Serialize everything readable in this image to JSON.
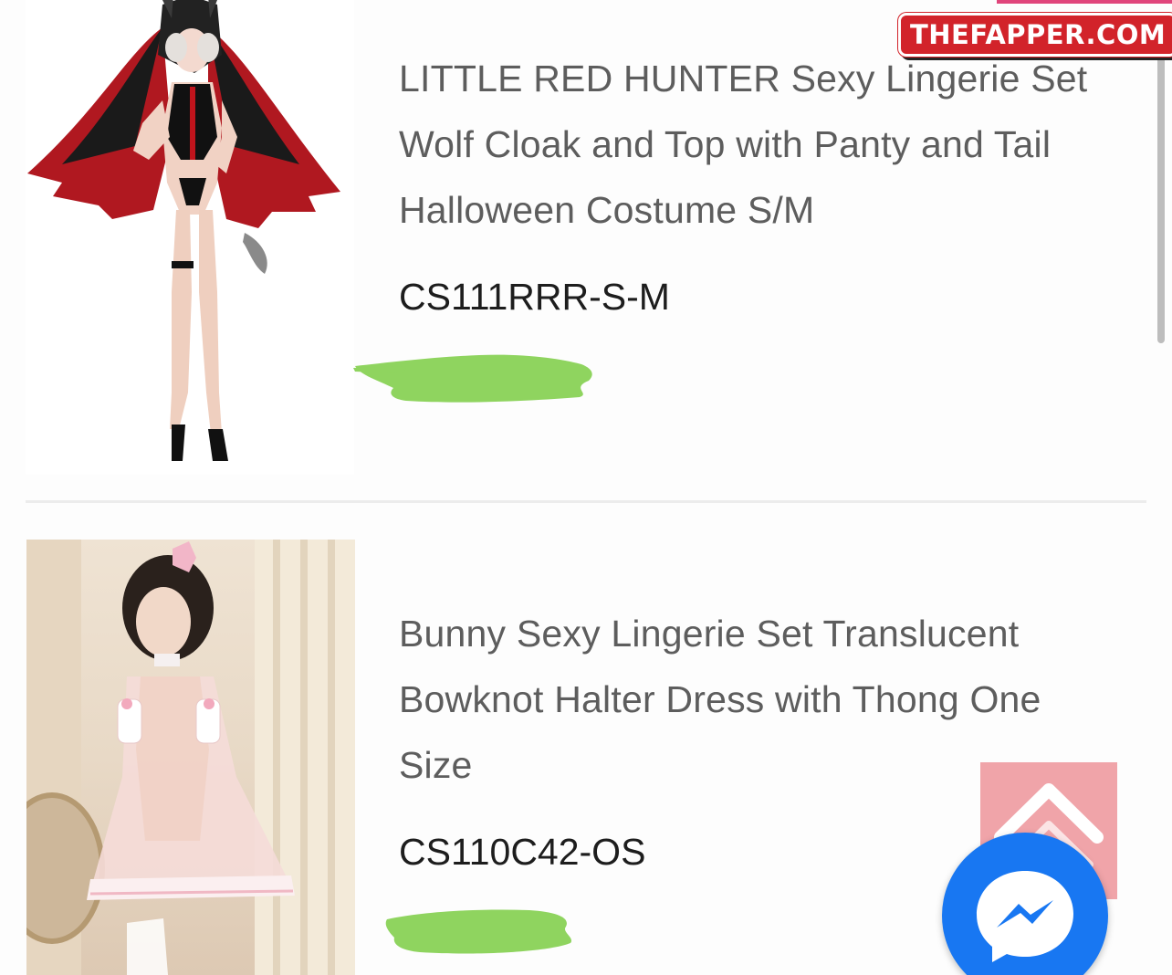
{
  "watermark": {
    "text": "THEFAPPER.COM"
  },
  "products": [
    {
      "title_lines": [
        "LITTLE RED HUNTER Sexy Lingerie Set",
        "Wolf Cloak and Top with Panty and Tail",
        "Halloween Costume S/M"
      ],
      "sku": "CS111RRR-S-M",
      "image_icon": "product-photo-icon",
      "price_redacted": true
    },
    {
      "title_lines": [
        "Bunny Sexy Lingerie Set Translucent",
        "Bowknot Halter Dress with Thong One",
        "Size"
      ],
      "sku": "CS110C42-OS",
      "image_icon": "product-photo-icon",
      "price_redacted": true
    }
  ],
  "floating_buttons": {
    "back_to_top_icon": "chevron-up-icon",
    "messenger_icon": "messenger-icon"
  },
  "colors": {
    "title_text": "#5d5d5d",
    "sku_text": "#1d1d1d",
    "redaction_green": "#8fd45f",
    "back_to_top_bg": "#f0a4a9",
    "messenger_blue": "#1877f2",
    "watermark_red": "#d2232a"
  }
}
